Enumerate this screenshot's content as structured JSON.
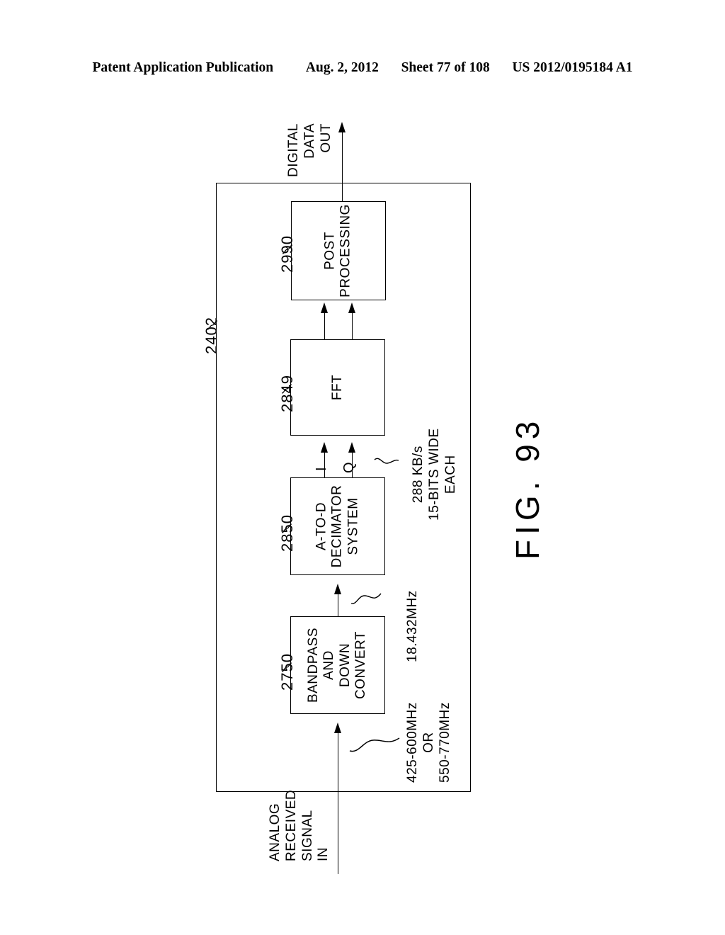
{
  "header": {
    "publication": "Patent Application Publication",
    "date": "Aug. 2, 2012",
    "sheet": "Sheet 77 of 108",
    "docnumber": "US 2012/0195184 A1"
  },
  "figure": {
    "caption": "FIG. 93",
    "enclosure_ref": "2402",
    "blocks": [
      {
        "ref": "2990",
        "label": "POST\nPROCESSING"
      },
      {
        "ref": "2849",
        "label": "FFT"
      },
      {
        "ref": "2850",
        "label": "A-TO-D\nDECIMATOR\nSYSTEM"
      },
      {
        "ref": "2750",
        "label": "BANDPASS\nAND\nDOWN\nCONVERT"
      }
    ],
    "signals": {
      "output_label": "DIGITAL\nDATA\nOUT",
      "input_label": "ANALOG\nRECEIVED\nSIGNAL\nIN",
      "i_label": "I",
      "q_label": "Q"
    },
    "annotations": {
      "rf_input_rate": "425-600MHz\nOR\n550-770MHz",
      "if_rate": "18.432MHz",
      "iq_rate": "288 KB/s\n15-BITS WIDE\nEACH"
    }
  }
}
